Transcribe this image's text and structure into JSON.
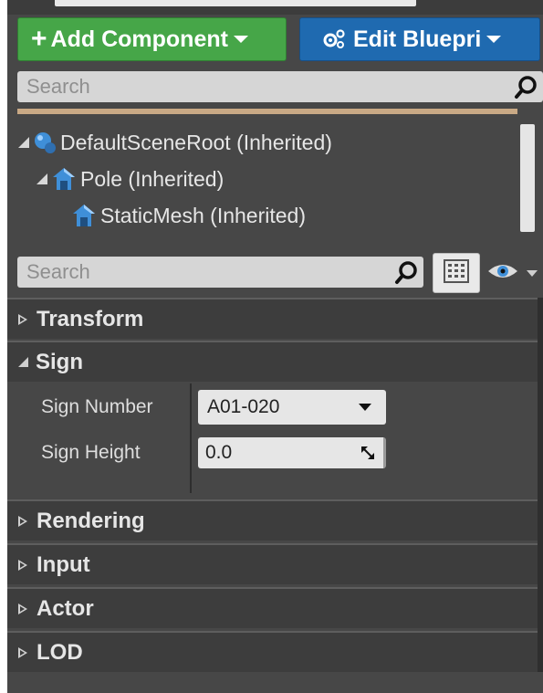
{
  "toolbar": {
    "add_component_label": "Add Component",
    "edit_blueprint_label": "Edit Bluepri"
  },
  "components_search": {
    "placeholder": "Search"
  },
  "component_tree": {
    "items": [
      {
        "label": "DefaultSceneRoot (Inherited)",
        "icon": "scene-root-sphere-icon"
      },
      {
        "label": "Pole (Inherited)",
        "icon": "static-mesh-icon"
      },
      {
        "label": "StaticMesh (Inherited)",
        "icon": "static-mesh-icon"
      }
    ]
  },
  "details_search": {
    "placeholder": "Search"
  },
  "categories": {
    "transform": "Transform",
    "sign": "Sign",
    "rendering": "Rendering",
    "input": "Input",
    "actor": "Actor",
    "lod": "LOD"
  },
  "sign_properties": {
    "sign_number_label": "Sign Number",
    "sign_number_value": "A01-020",
    "sign_height_label": "Sign Height",
    "sign_height_value": "0.0"
  },
  "colors": {
    "add_button": "#46a648",
    "edit_button": "#1f6ab0",
    "panel_bg": "#474747",
    "category_bg": "#3d3d3d",
    "accent_bar": "#c9a985"
  }
}
